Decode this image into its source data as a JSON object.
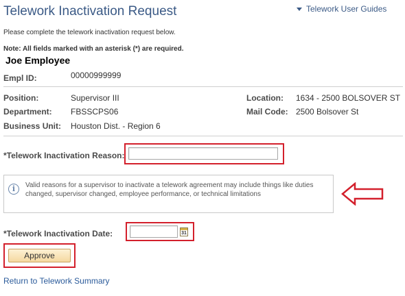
{
  "page": {
    "title": "Telework Inactivation Request",
    "guides_link": "Telework User Guides",
    "instructions": "Please complete the telework inactivation request below.",
    "note": "Note: All fields marked with an asterisk (*) are required."
  },
  "employee": {
    "name": "Joe Employee",
    "empl_id_label": "Empl ID:",
    "empl_id": "00000999999",
    "position_label": "Position:",
    "position": "Supervisor III",
    "department_label": "Department:",
    "department": "FBSSCPS06",
    "business_unit_label": "Business Unit:",
    "business_unit": "Houston Dist. - Region 6",
    "location_label": "Location:",
    "location": "1634 - 2500 BOLSOVER ST",
    "mail_code_label": "Mail Code:",
    "mail_code": "2500 Bolsover St"
  },
  "form": {
    "reason_label": "*Telework Inactivation Reason:",
    "reason_value": "",
    "info_text": "Valid reasons for a supervisor to inactivate a telework agreement may include things like duties changed, supervisor changed, employee performance, or technical limitations",
    "date_label": "*Telework Inactivation Date:",
    "date_value": "",
    "calendar_day": "31",
    "approve_label": "Approve",
    "return_link": "Return to Telework Summary"
  },
  "icons": {
    "info": "info-icon",
    "calendar": "calendar-icon",
    "arrow": "red-left-arrow",
    "dropdown": "dropdown-arrow-icon"
  },
  "colors": {
    "title_blue": "#3b5a86",
    "highlight_red": "#d31f2b",
    "button_fill": "#f5d9a0"
  }
}
